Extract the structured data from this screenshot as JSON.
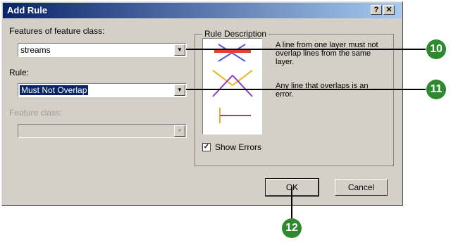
{
  "dialog": {
    "title": "Add Rule",
    "help_button": "?",
    "close_button": "✕"
  },
  "form": {
    "feature_class_label": "Features of feature class:",
    "feature_class_value": "streams",
    "rule_label": "Rule:",
    "rule_value": "Must Not Overlap",
    "target_feature_class_label": "Feature class:",
    "target_feature_class_value": ""
  },
  "description": {
    "group_label": "Rule Description",
    "text1": "A line from one layer must not overlap lines from the same layer.",
    "text2": "Any line that overlaps is an error.",
    "show_errors_label": "Show Errors",
    "show_errors_checked": true
  },
  "buttons": {
    "ok": "OK",
    "cancel": "Cancel"
  },
  "callouts": {
    "c10": "10",
    "c11": "11",
    "c12": "12"
  },
  "colors": {
    "error_red": "#e0442c",
    "line_blue": "#4a5ad8",
    "line_gold": "#e8b41a",
    "line_purple": "#8a3cc4",
    "callout_green": "#2f8a2f"
  }
}
